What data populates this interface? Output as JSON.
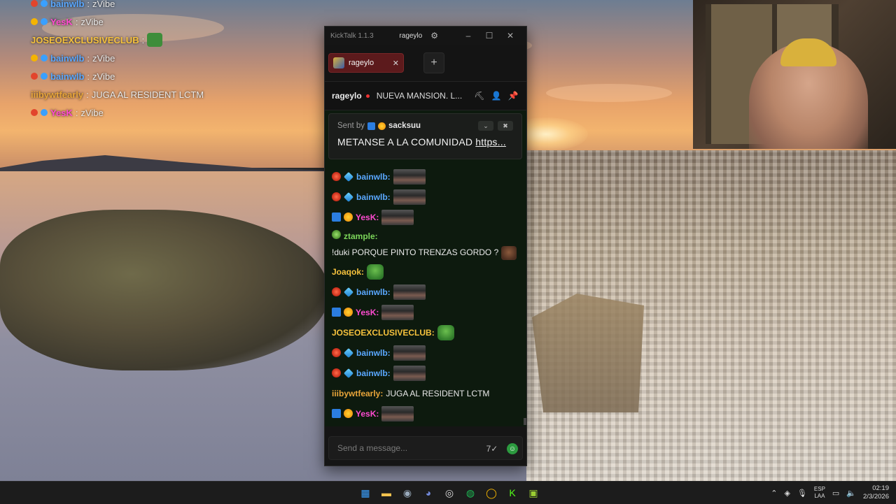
{
  "overlay_chat": [
    {
      "user": "bainwlb",
      "message": "zVibe",
      "color": "#5aa8ff"
    },
    {
      "user": "YesK",
      "message": "zVibe",
      "color": "#ff4bd1"
    },
    {
      "user": "JOSEOEXCLUSIVECLUB",
      "message": "",
      "color": "#f6c23d",
      "emote": "pepe-emote"
    },
    {
      "user": "bainwlb",
      "message": "zVibe",
      "color": "#5aa8ff"
    },
    {
      "user": "bainwlb",
      "message": "zVibe",
      "color": "#5aa8ff"
    },
    {
      "user": "iiibywtfearly",
      "message": "JUGA AL RESIDENT LCTM",
      "color": "#e8a53a"
    },
    {
      "user": "YesK",
      "message": "zVibe",
      "color": "#ff4bd1"
    }
  ],
  "app": {
    "title": "KickTalk 1.1.3",
    "account": "rageylo",
    "tab_label": "rageylo",
    "stream": {
      "name": "rageylo",
      "title": "NUEVA MANSION. L..."
    },
    "pinned": {
      "sent_by": "Sent by",
      "sender": "sacksuu",
      "message": "METANSE A LA COMUNIDAD ",
      "link": "https..."
    },
    "messages": [
      {
        "badges": [
          "b-red",
          "b-blue"
        ],
        "user": "bainwlb",
        "color": "#5aa8ff",
        "text": "",
        "emote": "emote"
      },
      {
        "badges": [
          "b-red",
          "b-blue"
        ],
        "user": "bainwlb",
        "color": "#5aa8ff",
        "text": "",
        "emote": "emote"
      },
      {
        "badges": [
          "b-pick",
          "b-sun"
        ],
        "user": "YesK",
        "color": "#ff4bd1",
        "text": "",
        "emote": "emote"
      },
      {
        "badges": [
          "b-frog"
        ],
        "user": "ztample",
        "color": "#7cd65a",
        "text": "!duki PORQUE PINTO TRENZAS GORDO ?",
        "emote": "face",
        "multi": true
      },
      {
        "badges": [],
        "user": "Joaqok",
        "color": "#f6c23d",
        "text": "",
        "emote": "green"
      },
      {
        "badges": [
          "b-red",
          "b-blue"
        ],
        "user": "bainwlb",
        "color": "#5aa8ff",
        "text": "",
        "emote": "emote"
      },
      {
        "badges": [
          "b-pick",
          "b-sun"
        ],
        "user": "YesK",
        "color": "#ff4bd1",
        "text": "",
        "emote": "emote"
      },
      {
        "badges": [],
        "user": "JOSEOEXCLUSIVECLUB",
        "color": "#f6c23d",
        "text": "",
        "emote": "green"
      },
      {
        "badges": [
          "b-red",
          "b-blue"
        ],
        "user": "bainwlb",
        "color": "#5aa8ff",
        "text": "",
        "emote": "emote"
      },
      {
        "badges": [
          "b-red",
          "b-blue"
        ],
        "user": "bainwlb",
        "color": "#5aa8ff",
        "text": "",
        "emote": "emote"
      },
      {
        "badges": [],
        "user": "iiibywtfearly",
        "color": "#e8a53a",
        "text": "JUGA AL RESIDENT LCTM",
        "emote": ""
      },
      {
        "badges": [
          "b-pick",
          "b-sun"
        ],
        "user": "YesK",
        "color": "#ff4bd1",
        "text": "",
        "emote": "emote"
      }
    ],
    "input_placeholder": "Send a message..."
  },
  "taskbar": {
    "apps": [
      {
        "name": "windows-start-icon",
        "glyph": "▦",
        "color": "#3aa0ff"
      },
      {
        "name": "file-explorer-icon",
        "glyph": "▬",
        "color": "#f2c14e"
      },
      {
        "name": "steam-icon",
        "glyph": "◉",
        "color": "#9ab"
      },
      {
        "name": "discord-icon",
        "glyph": "◕",
        "color": "#7289da"
      },
      {
        "name": "obs-icon",
        "glyph": "◎",
        "color": "#ddd"
      },
      {
        "name": "spotify-icon",
        "glyph": "◍",
        "color": "#1db954"
      },
      {
        "name": "chrome-icon",
        "glyph": "◯",
        "color": "#f4b400"
      },
      {
        "name": "kicktalk-icon",
        "glyph": "K",
        "color": "#53fc18"
      },
      {
        "name": "game-app-icon",
        "glyph": "▣",
        "color": "#9acd32"
      }
    ],
    "lang_top": "ESP",
    "lang_bottom": "LAA",
    "time": "02:19",
    "date": "2/3/2026"
  }
}
